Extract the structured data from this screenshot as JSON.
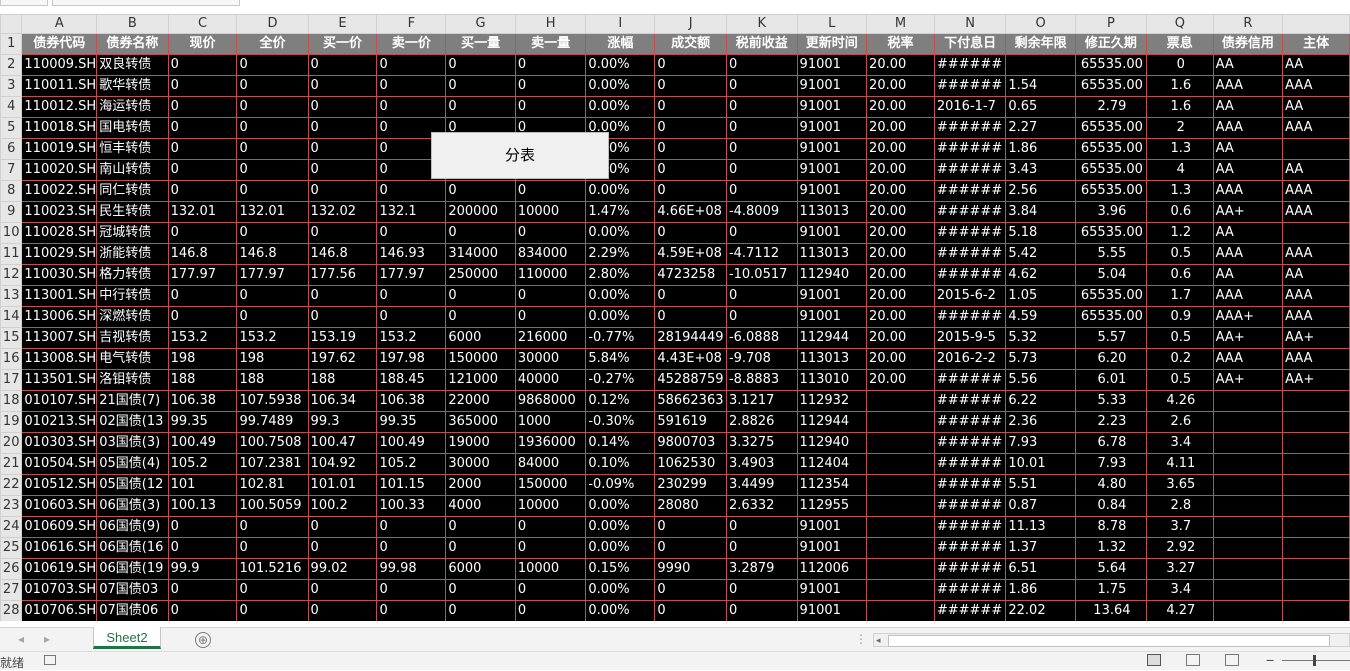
{
  "columns": [
    "A",
    "B",
    "C",
    "D",
    "E",
    "F",
    "G",
    "H",
    "I",
    "J",
    "K",
    "L",
    "M",
    "N",
    "O",
    "P",
    "Q",
    "R",
    ""
  ],
  "headers": [
    "债券代码",
    "债券名称",
    "现价",
    "全价",
    "买一价",
    "卖一价",
    "买一量",
    "卖一量",
    "涨幅",
    "成交额",
    "税前收益",
    "更新时间",
    "税率",
    "下付息日",
    "剩余年限",
    "修正久期",
    "票息",
    "债券信用",
    "主体"
  ],
  "rows": [
    [
      "110009.SH",
      "双良转债",
      "0",
      "0",
      "0",
      "0",
      "0",
      "0",
      "0.00%",
      "0",
      "0",
      "91001",
      "20.00",
      "######",
      "",
      "65535.00",
      "0",
      "AA",
      "AA"
    ],
    [
      "110011.SH",
      "歌华转债",
      "0",
      "0",
      "0",
      "0",
      "0",
      "0",
      "0.00%",
      "0",
      "0",
      "91001",
      "20.00",
      "######",
      "1.54",
      "65535.00",
      "1.6",
      "AAA",
      "AAA"
    ],
    [
      "110012.SH",
      "海运转债",
      "0",
      "0",
      "0",
      "0",
      "0",
      "0",
      "0.00%",
      "0",
      "0",
      "91001",
      "20.00",
      "2016-1-7",
      "0.65",
      "2.79",
      "1.6",
      "AA",
      "AA"
    ],
    [
      "110018.SH",
      "国电转债",
      "0",
      "0",
      "0",
      "0",
      "0",
      "0",
      "0.00%",
      "0",
      "0",
      "91001",
      "20.00",
      "######",
      "2.27",
      "65535.00",
      "2",
      "AAA",
      "AAA"
    ],
    [
      "110019.SH",
      "恒丰转债",
      "0",
      "0",
      "0",
      "0",
      "",
      "",
      "0.00%",
      "0",
      "0",
      "91001",
      "20.00",
      "######",
      "1.86",
      "65535.00",
      "1.3",
      "AA",
      ""
    ],
    [
      "110020.SH",
      "南山转债",
      "0",
      "0",
      "0",
      "0",
      "",
      "",
      "0.00%",
      "0",
      "0",
      "91001",
      "20.00",
      "######",
      "3.43",
      "65535.00",
      "4",
      "AA",
      "AA"
    ],
    [
      "110022.SH",
      "同仁转债",
      "0",
      "0",
      "0",
      "0",
      "0",
      "0",
      "0.00%",
      "0",
      "0",
      "91001",
      "20.00",
      "######",
      "2.56",
      "65535.00",
      "1.3",
      "AAA",
      "AAA"
    ],
    [
      "110023.SH",
      "民生转债",
      "132.01",
      "132.01",
      "132.02",
      "132.1",
      "200000",
      "10000",
      "1.47%",
      "4.66E+08",
      "-4.8009",
      "113013",
      "20.00",
      "######",
      "3.84",
      "3.96",
      "0.6",
      "AA+",
      "AAA"
    ],
    [
      "110028.SH",
      "冠城转债",
      "0",
      "0",
      "0",
      "0",
      "0",
      "0",
      "0.00%",
      "0",
      "0",
      "91001",
      "20.00",
      "######",
      "5.18",
      "65535.00",
      "1.2",
      "AA",
      ""
    ],
    [
      "110029.SH",
      "浙能转债",
      "146.8",
      "146.8",
      "146.8",
      "146.93",
      "314000",
      "834000",
      "2.29%",
      "4.59E+08",
      "-4.7112",
      "113013",
      "20.00",
      "######",
      "5.42",
      "5.55",
      "0.5",
      "AAA",
      "AAA"
    ],
    [
      "110030.SH",
      "格力转债",
      "177.97",
      "177.97",
      "177.56",
      "177.97",
      "250000",
      "110000",
      "2.80%",
      "4723258",
      "-10.0517",
      "112940",
      "20.00",
      "######",
      "4.62",
      "5.04",
      "0.6",
      "AA",
      "AA"
    ],
    [
      "113001.SH",
      "中行转债",
      "0",
      "0",
      "0",
      "0",
      "0",
      "0",
      "0.00%",
      "0",
      "0",
      "91001",
      "20.00",
      "2015-6-2",
      "1.05",
      "65535.00",
      "1.7",
      "AAA",
      "AAA"
    ],
    [
      "113006.SH",
      "深燃转债",
      "0",
      "0",
      "0",
      "0",
      "0",
      "0",
      "0.00%",
      "0",
      "0",
      "91001",
      "20.00",
      "######",
      "4.59",
      "65535.00",
      "0.9",
      "AAA+",
      "AAA"
    ],
    [
      "113007.SH",
      "吉视转债",
      "153.2",
      "153.2",
      "153.19",
      "153.2",
      "6000",
      "216000",
      "-0.77%",
      "28194449",
      "-6.0888",
      "112944",
      "20.00",
      "2015-9-5",
      "5.32",
      "5.57",
      "0.5",
      "AA+",
      "AA+"
    ],
    [
      "113008.SH",
      "电气转债",
      "198",
      "198",
      "197.62",
      "197.98",
      "150000",
      "30000",
      "5.84%",
      "4.43E+08",
      "-9.708",
      "113013",
      "20.00",
      "2016-2-2",
      "5.73",
      "6.20",
      "0.2",
      "AAA",
      "AAA"
    ],
    [
      "113501.SH",
      "洛钼转债",
      "188",
      "188",
      "188",
      "188.45",
      "121000",
      "40000",
      "-0.27%",
      "45288759",
      "-8.8883",
      "113010",
      "20.00",
      "######",
      "5.56",
      "6.01",
      "0.5",
      "AA+",
      "AA+"
    ],
    [
      "010107.SH",
      "21国债(7)",
      "106.38",
      "107.5938",
      "106.34",
      "106.38",
      "22000",
      "9868000",
      "0.12%",
      "58662363",
      "3.1217",
      "112932",
      "",
      "######",
      "6.22",
      "5.33",
      "4.26",
      "",
      ""
    ],
    [
      "010213.SH",
      "02国债(13",
      "99.35",
      "99.7489",
      "99.3",
      "99.35",
      "365000",
      "1000",
      "-0.30%",
      "591619",
      "2.8826",
      "112944",
      "",
      "######",
      "2.36",
      "2.23",
      "2.6",
      "",
      ""
    ],
    [
      "010303.SH",
      "03国债(3)",
      "100.49",
      "100.7508",
      "100.47",
      "100.49",
      "19000",
      "1936000",
      "0.14%",
      "9800703",
      "3.3275",
      "112940",
      "",
      "######",
      "7.93",
      "6.78",
      "3.4",
      "",
      ""
    ],
    [
      "010504.SH",
      "05国债(4)",
      "105.2",
      "107.2381",
      "104.92",
      "105.2",
      "30000",
      "84000",
      "0.10%",
      "1062530",
      "3.4903",
      "112404",
      "",
      "######",
      "10.01",
      "7.93",
      "4.11",
      "",
      ""
    ],
    [
      "010512.SH",
      "05国债(12",
      "101",
      "102.81",
      "101.01",
      "101.15",
      "2000",
      "150000",
      "-0.09%",
      "230299",
      "3.4499",
      "112354",
      "",
      "######",
      "5.51",
      "4.80",
      "3.65",
      "",
      ""
    ],
    [
      "010603.SH",
      "06国债(3)",
      "100.13",
      "100.5059",
      "100.2",
      "100.33",
      "4000",
      "10000",
      "0.00%",
      "28080",
      "2.6332",
      "112955",
      "",
      "######",
      "0.87",
      "0.84",
      "2.8",
      "",
      ""
    ],
    [
      "010609.SH",
      "06国债(9)",
      "0",
      "0",
      "0",
      "0",
      "0",
      "0",
      "0.00%",
      "0",
      "0",
      "91001",
      "",
      "######",
      "11.13",
      "8.78",
      "3.7",
      "",
      ""
    ],
    [
      "010616.SH",
      "06国债(16",
      "0",
      "0",
      "0",
      "0",
      "0",
      "0",
      "0.00%",
      "0",
      "0",
      "91001",
      "",
      "######",
      "1.37",
      "1.32",
      "2.92",
      "",
      ""
    ],
    [
      "010619.SH",
      "06国债(19",
      "99.9",
      "101.5216",
      "99.02",
      "99.98",
      "6000",
      "10000",
      "0.15%",
      "9990",
      "3.2879",
      "112006",
      "",
      "######",
      "6.51",
      "5.64",
      "3.27",
      "",
      ""
    ],
    [
      "010703.SH",
      "07国债03",
      "0",
      "0",
      "0",
      "0",
      "0",
      "0",
      "0.00%",
      "0",
      "0",
      "91001",
      "",
      "######",
      "1.86",
      "1.75",
      "3.4",
      "",
      ""
    ],
    [
      "010706.SH",
      "07国债06",
      "0",
      "0",
      "0",
      "0",
      "0",
      "0",
      "0.00%",
      "0",
      "0",
      "91001",
      "",
      "######",
      "22.02",
      "13.64",
      "4.27",
      "",
      ""
    ]
  ],
  "float_button": {
    "label": "分表"
  },
  "sheet_tab": {
    "label": "Sheet2"
  },
  "add_sheet": {
    "label": "⊕"
  },
  "status": {
    "ready": "就绪"
  },
  "colors": {
    "cell_bg": "#000000",
    "cell_border": "#c0504d",
    "header_bg": "#7f7f7f",
    "tab_accent": "#217346"
  }
}
